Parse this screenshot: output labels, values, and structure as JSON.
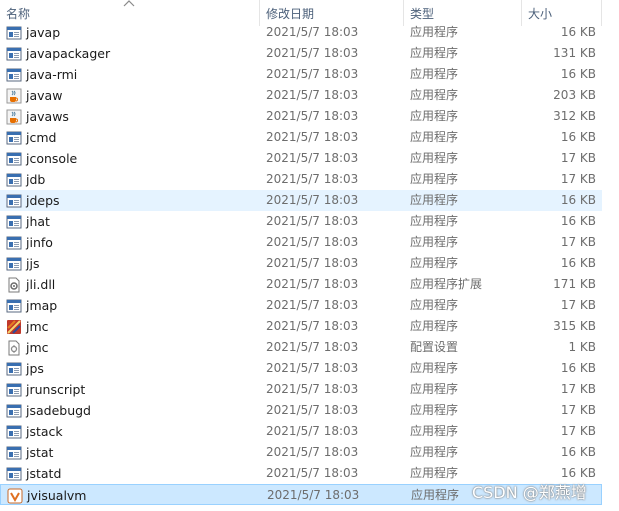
{
  "columns": {
    "name": "名称",
    "date": "修改日期",
    "type": "类型",
    "size": "大小"
  },
  "files": [
    {
      "name": "javap",
      "date": "2021/5/7 18:03",
      "type": "应用程序",
      "size": "16 KB",
      "icon": "exe-icon"
    },
    {
      "name": "javapackager",
      "date": "2021/5/7 18:03",
      "type": "应用程序",
      "size": "131 KB",
      "icon": "exe-icon"
    },
    {
      "name": "java-rmi",
      "date": "2021/5/7 18:03",
      "type": "应用程序",
      "size": "16 KB",
      "icon": "exe-icon"
    },
    {
      "name": "javaw",
      "date": "2021/5/7 18:03",
      "type": "应用程序",
      "size": "203 KB",
      "icon": "java-cup-icon"
    },
    {
      "name": "javaws",
      "date": "2021/5/7 18:03",
      "type": "应用程序",
      "size": "312 KB",
      "icon": "java-cup-icon"
    },
    {
      "name": "jcmd",
      "date": "2021/5/7 18:03",
      "type": "应用程序",
      "size": "16 KB",
      "icon": "exe-icon"
    },
    {
      "name": "jconsole",
      "date": "2021/5/7 18:03",
      "type": "应用程序",
      "size": "17 KB",
      "icon": "exe-icon"
    },
    {
      "name": "jdb",
      "date": "2021/5/7 18:03",
      "type": "应用程序",
      "size": "17 KB",
      "icon": "exe-icon"
    },
    {
      "name": "jdeps",
      "date": "2021/5/7 18:03",
      "type": "应用程序",
      "size": "16 KB",
      "icon": "exe-icon",
      "state": "hover"
    },
    {
      "name": "jhat",
      "date": "2021/5/7 18:03",
      "type": "应用程序",
      "size": "16 KB",
      "icon": "exe-icon"
    },
    {
      "name": "jinfo",
      "date": "2021/5/7 18:03",
      "type": "应用程序",
      "size": "17 KB",
      "icon": "exe-icon"
    },
    {
      "name": "jjs",
      "date": "2021/5/7 18:03",
      "type": "应用程序",
      "size": "16 KB",
      "icon": "exe-icon"
    },
    {
      "name": "jli.dll",
      "date": "2021/5/7 18:03",
      "type": "应用程序扩展",
      "size": "171 KB",
      "icon": "dll-gear-icon"
    },
    {
      "name": "jmap",
      "date": "2021/5/7 18:03",
      "type": "应用程序",
      "size": "17 KB",
      "icon": "exe-icon"
    },
    {
      "name": "jmc",
      "date": "2021/5/7 18:03",
      "type": "应用程序",
      "size": "315 KB",
      "icon": "mission-control-icon"
    },
    {
      "name": "jmc",
      "date": "2021/5/7 18:03",
      "type": "配置设置",
      "size": "1 KB",
      "icon": "config-file-icon"
    },
    {
      "name": "jps",
      "date": "2021/5/7 18:03",
      "type": "应用程序",
      "size": "16 KB",
      "icon": "exe-icon"
    },
    {
      "name": "jrunscript",
      "date": "2021/5/7 18:03",
      "type": "应用程序",
      "size": "17 KB",
      "icon": "exe-icon"
    },
    {
      "name": "jsadebugd",
      "date": "2021/5/7 18:03",
      "type": "应用程序",
      "size": "17 KB",
      "icon": "exe-icon"
    },
    {
      "name": "jstack",
      "date": "2021/5/7 18:03",
      "type": "应用程序",
      "size": "17 KB",
      "icon": "exe-icon"
    },
    {
      "name": "jstat",
      "date": "2021/5/7 18:03",
      "type": "应用程序",
      "size": "16 KB",
      "icon": "exe-icon"
    },
    {
      "name": "jstatd",
      "date": "2021/5/7 18:03",
      "type": "应用程序",
      "size": "16 KB",
      "icon": "exe-icon"
    },
    {
      "name": "jvisualvm",
      "date": "2021/5/7 18:03",
      "type": "应用程序",
      "size": "",
      "icon": "visualvm-icon",
      "state": "selected"
    }
  ],
  "watermark": "CSDN @郑燕增"
}
